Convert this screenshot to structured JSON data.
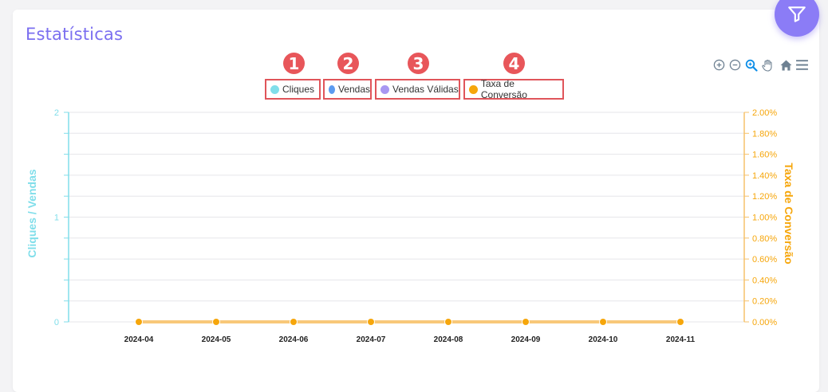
{
  "card": {
    "title": "Estatísticas"
  },
  "toolbar": {
    "icons": [
      "zoom-in-icon",
      "zoom-out-icon",
      "zoom-selection-icon",
      "pan-icon",
      "home-icon",
      "menu-icon"
    ]
  },
  "badges": [
    "1",
    "2",
    "3",
    "4"
  ],
  "legend": [
    {
      "label": "Cliques",
      "color": "#80deea"
    },
    {
      "label": "Vendas",
      "color": "#5b9bf0"
    },
    {
      "label": "Vendas Válidas",
      "color": "#a897f2"
    },
    {
      "label": "Taxa de Conversão",
      "color": "#f6a60b"
    }
  ],
  "chart_data": {
    "type": "line",
    "categories": [
      "2024-04",
      "2024-05",
      "2024-06",
      "2024-07",
      "2024-08",
      "2024-09",
      "2024-10",
      "2024-11"
    ],
    "series": [
      {
        "name": "Cliques",
        "values": [
          0,
          0,
          0,
          0,
          0,
          0,
          0,
          0
        ],
        "axis": "left"
      },
      {
        "name": "Vendas",
        "values": [
          0,
          0,
          0,
          0,
          0,
          0,
          0,
          0
        ],
        "axis": "left"
      },
      {
        "name": "Vendas Válidas",
        "values": [
          0,
          0,
          0,
          0,
          0,
          0,
          0,
          0
        ],
        "axis": "left"
      },
      {
        "name": "Taxa de Conversão",
        "values": [
          0,
          0,
          0,
          0,
          0,
          0,
          0,
          0
        ],
        "axis": "right"
      }
    ],
    "ylabel_left": "Cliques / Vendas",
    "ylabel_right": "Taxa de Conversão",
    "ylim_left": [
      0,
      2
    ],
    "ylim_right": [
      0,
      2
    ],
    "yticks_left": [
      "0",
      "1",
      "2"
    ],
    "yticks_right": [
      "0.00%",
      "0.20%",
      "0.40%",
      "0.60%",
      "0.80%",
      "1.00%",
      "1.20%",
      "1.40%",
      "1.60%",
      "1.80%",
      "2.00%"
    ],
    "grid": true,
    "legend_position": "top-center",
    "colors": {
      "left_axis": "#80deea",
      "right_axis": "#f6a60b",
      "grid": "#e6e6ea"
    }
  }
}
